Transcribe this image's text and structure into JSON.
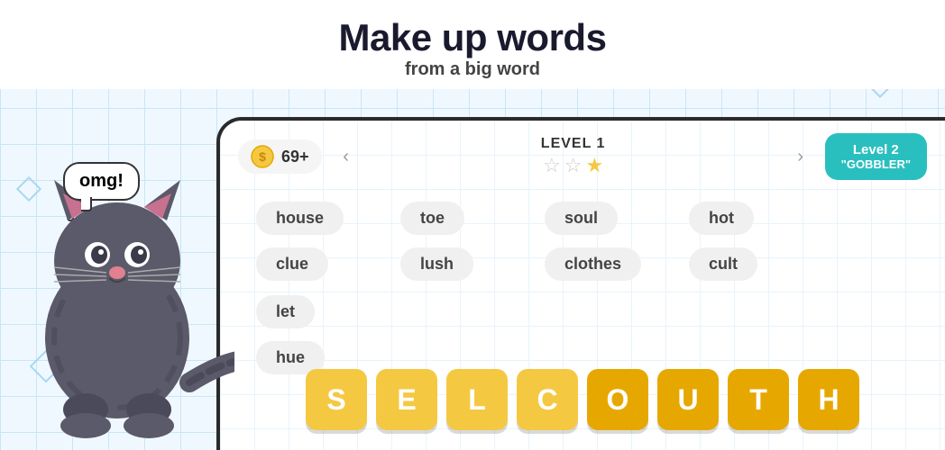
{
  "header": {
    "main_title": "Make up words",
    "sub_title": "from a big word"
  },
  "game": {
    "coins": "69+",
    "level_label": "LEVEL 1",
    "stars": [
      "☆",
      "☆",
      "★"
    ],
    "next_level": {
      "label": "Level 2",
      "name": "\"GOBBLER\""
    },
    "words": [
      [
        "house",
        "clue"
      ],
      [
        "toe",
        "lush"
      ],
      [
        "soul",
        "clothes"
      ],
      [
        "hot",
        "cult"
      ],
      [
        "let",
        "hue"
      ]
    ],
    "tiles": [
      "S",
      "E",
      "L",
      "C",
      "O",
      "U",
      "T",
      "H"
    ],
    "bubble_text": "omg!"
  }
}
